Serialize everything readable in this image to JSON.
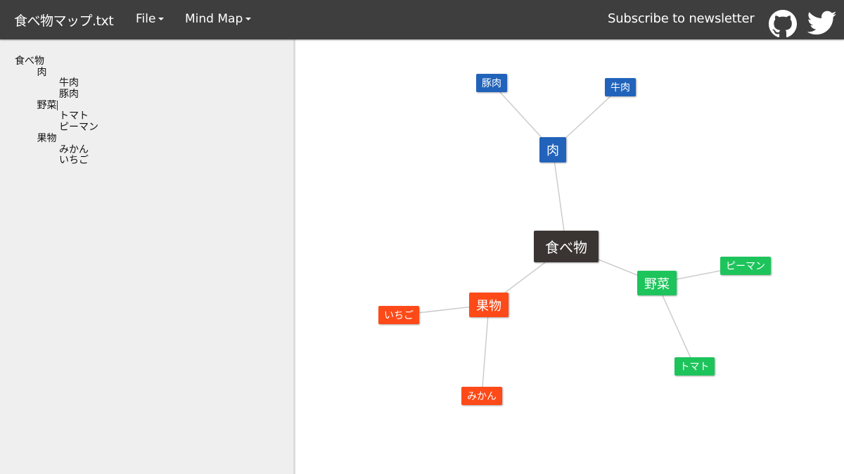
{
  "header": {
    "app_title": "食べ物マップ.txt",
    "menus": [
      {
        "label": "File"
      },
      {
        "label": "Mind Map"
      }
    ],
    "subscribe_label": "Subscribe to newsletter",
    "icons": [
      "github-icon",
      "twitter-icon"
    ]
  },
  "editor": {
    "lines": [
      {
        "indent": 0,
        "text": "食べ物"
      },
      {
        "indent": 1,
        "text": "肉"
      },
      {
        "indent": 2,
        "text": "牛肉"
      },
      {
        "indent": 2,
        "text": "豚肉"
      },
      {
        "indent": 1,
        "text": "野菜",
        "cursor": true
      },
      {
        "indent": 2,
        "text": "トマト"
      },
      {
        "indent": 2,
        "text": "ピーマン"
      },
      {
        "indent": 1,
        "text": "果物"
      },
      {
        "indent": 2,
        "text": "みかん"
      },
      {
        "indent": 2,
        "text": "いちご"
      }
    ]
  },
  "colors": {
    "header_bg": "#3e3e3e",
    "sidebar_bg": "#efefef",
    "root": "#3a3533",
    "meat": "#2163bb",
    "vegetable": "#1dc45b",
    "fruit": "#fd4a18",
    "edge": "#cccccc"
  },
  "mindmap": {
    "root": {
      "label": "食べ物",
      "color": "root"
    },
    "branches": [
      {
        "label": "肉",
        "color": "meat",
        "children": [
          "豚肉",
          "牛肉"
        ]
      },
      {
        "label": "野菜",
        "color": "vegetable",
        "children": [
          "ピーマン",
          "トマト"
        ]
      },
      {
        "label": "果物",
        "color": "fruit",
        "children": [
          "いちご",
          "みかん"
        ]
      }
    ]
  }
}
